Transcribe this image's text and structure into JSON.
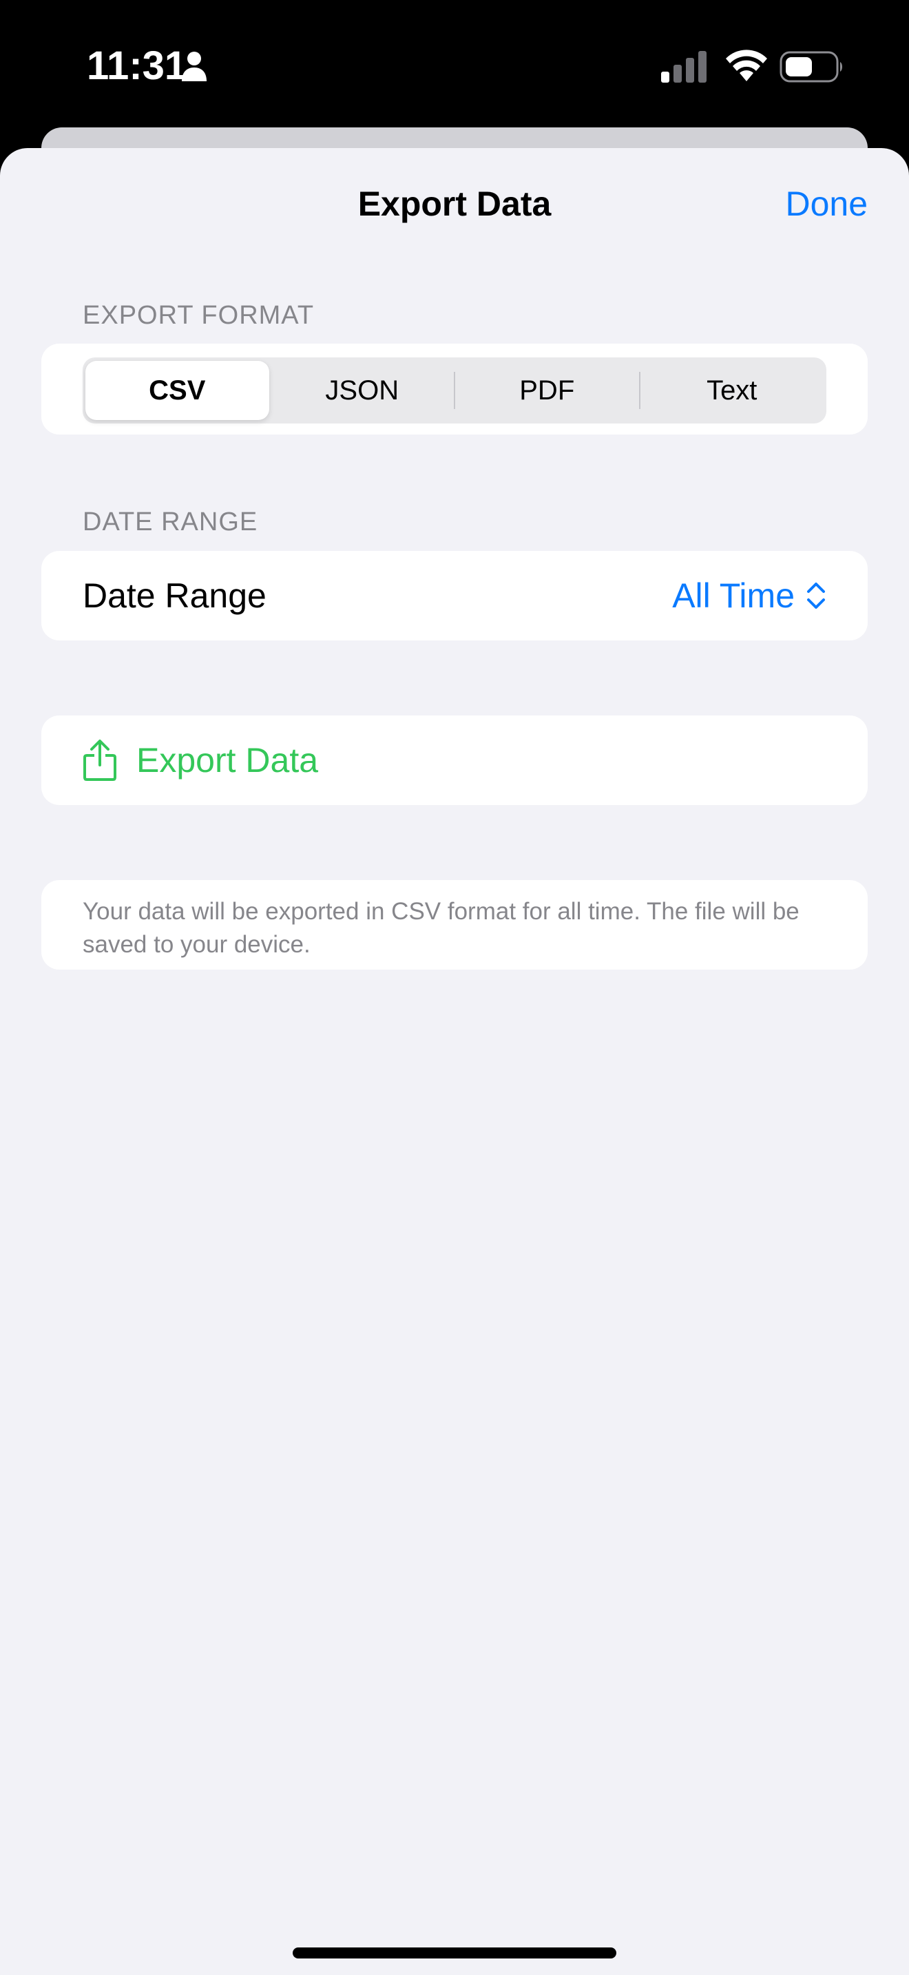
{
  "status_bar": {
    "time": "11:31",
    "icons": [
      "person-icon",
      "signal-icon",
      "wifi-icon",
      "battery-icon"
    ]
  },
  "nav": {
    "title": "Export Data",
    "done_label": "Done"
  },
  "export_format": {
    "header": "EXPORT FORMAT",
    "options": [
      "CSV",
      "JSON",
      "PDF",
      "Text"
    ],
    "selected": "CSV"
  },
  "date_range": {
    "header": "DATE RANGE",
    "label": "Date Range",
    "value": "All Time"
  },
  "export_action": {
    "label": "Export Data",
    "icon": "share-icon"
  },
  "info": {
    "text": "Your data will be exported in CSV format for all time. The file will be saved to your device."
  },
  "colors": {
    "accent_blue": "#0a7aff",
    "accent_green": "#34c759",
    "background": "#f2f2f7",
    "secondary_text": "#86868b"
  }
}
